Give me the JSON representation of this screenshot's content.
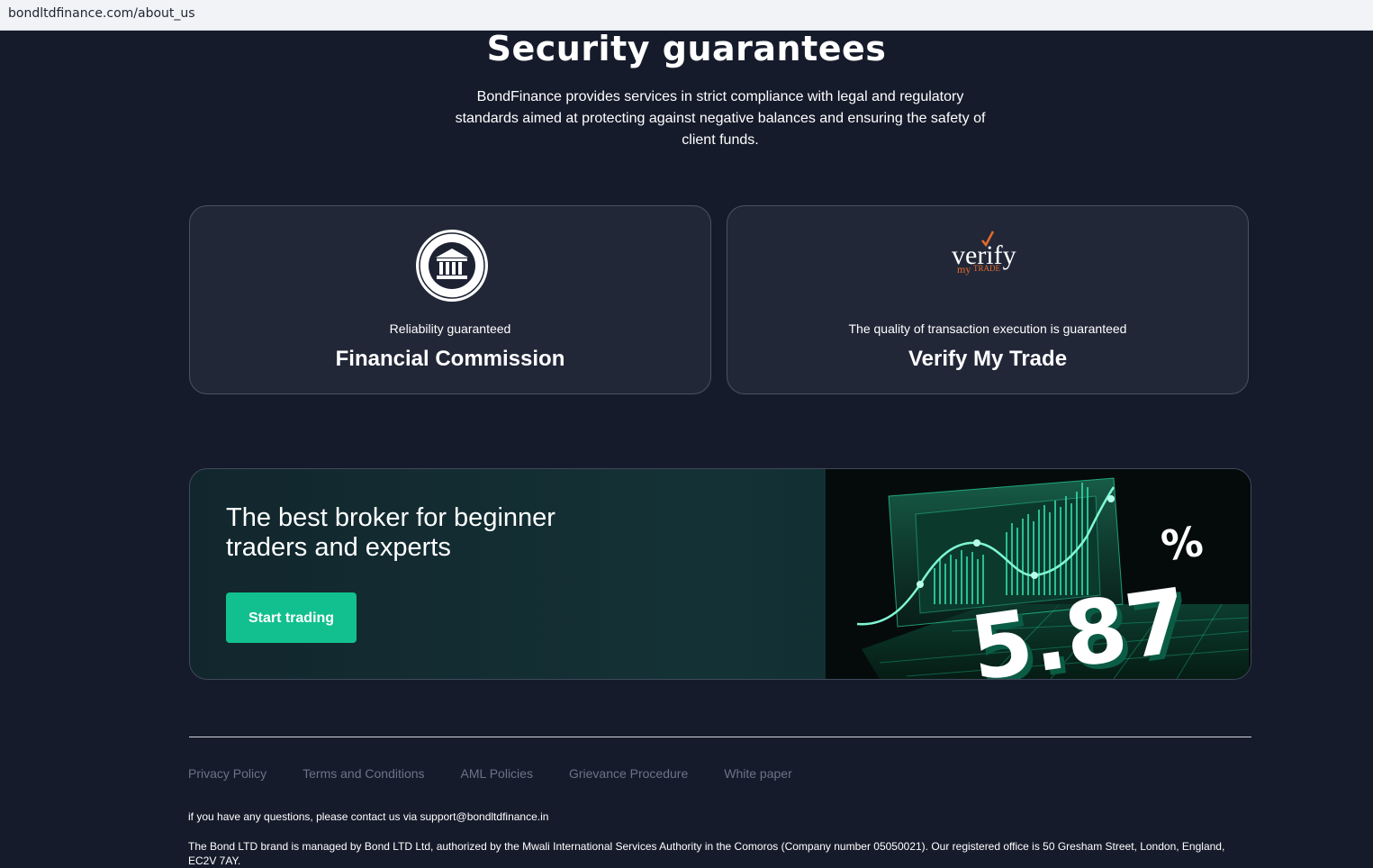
{
  "browser": {
    "url": "bondltdfinance.com/about_us"
  },
  "section": {
    "title": "Security guarantees",
    "subtitle": "BondFinance provides services in strict compliance with legal and regulatory standards aimed at protecting against negative balances and ensuring the safety of client funds."
  },
  "cards": [
    {
      "logo_icon": "financial-commission-logo",
      "subtitle": "Reliability guaranteed",
      "name": "Financial Commission"
    },
    {
      "logo_icon": "verify-my-trade-logo",
      "subtitle": "The quality of transaction execution is guaranteed",
      "name": "Verify My Trade"
    }
  ],
  "banner": {
    "title": "The best broker for beginner traders and experts",
    "button_label": "Start trading",
    "art_text": "5.87",
    "art_percent": "%"
  },
  "footer": {
    "links": [
      "Privacy Policy",
      "Terms and Conditions",
      "AML Policies",
      "Grievance Procedure",
      "White paper"
    ],
    "contact": "if you have any questions, please contact us via support@bondltdfinance.in",
    "legal": "The Bond LTD brand is managed by Bond LTD Ltd, authorized by the Mwali International Services Authority in the Comoros (Company number 05050021). Our registered office is 50 Gresham Street, London, England, EC2V 7AY."
  },
  "colors": {
    "background": "#161b2b",
    "card": "#222738",
    "accent": "#12c08f",
    "link": "#6c7386"
  }
}
